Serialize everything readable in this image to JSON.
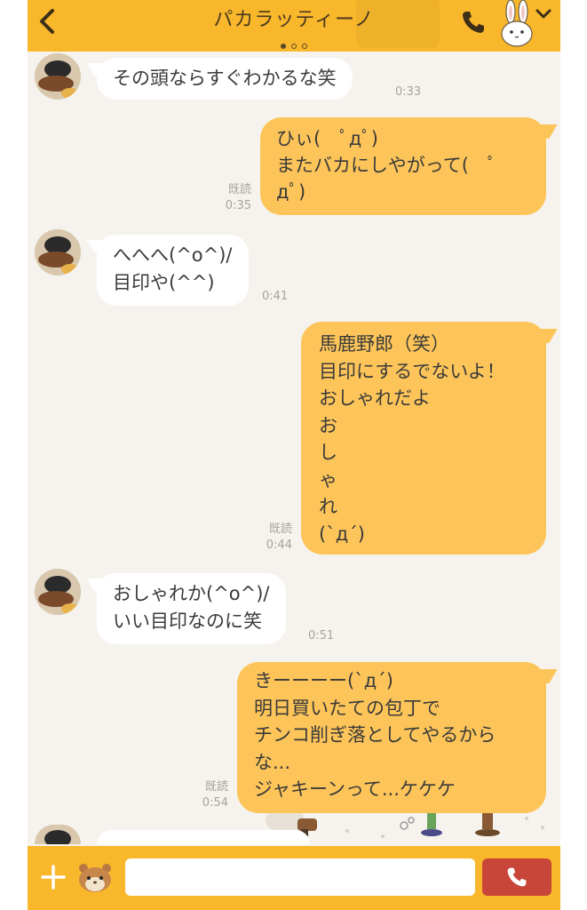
{
  "header": {
    "title": "パカラッティーノ",
    "page_indicator": {
      "count": 3,
      "active": 1
    }
  },
  "messages": [
    {
      "id": "m1",
      "side": "in",
      "text": "その頭ならすぐわかるな笑",
      "time": "0:33",
      "read": ""
    },
    {
      "id": "m2",
      "side": "out",
      "text": "ひぃ(　ﾟдﾟ)\nまたバカにしやがって(　ﾟ\nдﾟ)",
      "time": "0:35",
      "read": "既読"
    },
    {
      "id": "m3",
      "side": "in",
      "text": "へへへ(^o^)/\n目印や(^^)",
      "time": "0:41",
      "read": ""
    },
    {
      "id": "m4",
      "side": "out",
      "text": "馬鹿野郎（笑）\n目印にするでないよ！\nおしゃれだよ\nお\nし\nゃ\nれ\n(`д´)",
      "time": "0:44",
      "read": "既読"
    },
    {
      "id": "m5",
      "side": "in",
      "text": "おしゃれか(^o^)/\nいい目印なのに笑",
      "time": "0:51",
      "read": ""
    },
    {
      "id": "m6",
      "side": "out",
      "text": "きーーーー(`д´)\n明日買いたての包丁で\nチンコ削ぎ落としてやるから\nな...\nジャキーンって...ケケケ",
      "time": "0:54",
      "read": "既読"
    }
  ],
  "input": {
    "value": "",
    "placeholder": ""
  },
  "colors": {
    "header_bg": "#f9b72b",
    "outgoing_bubble": "#fdc559",
    "incoming_bubble": "#ffffff",
    "chat_bg": "#f6f3ee",
    "call_button": "#c8453a"
  },
  "icons": {
    "back": "chevron-left-icon",
    "call": "phone-icon",
    "profile": "rabbit-icon",
    "menu": "chevron-down-icon",
    "add": "plus-icon",
    "sticker": "hamster-icon",
    "send_call": "phone-icon"
  }
}
